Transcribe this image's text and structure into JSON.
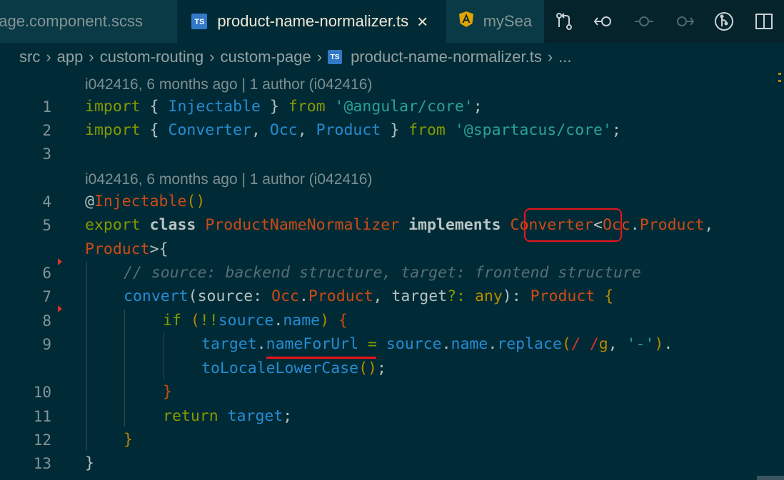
{
  "tabs": [
    {
      "label": "page.component.scss",
      "state": "inactive"
    },
    {
      "label": "product-name-normalizer.ts",
      "state": "active",
      "icon": "ts-icon",
      "badge": "TS"
    },
    {
      "label": "mySea",
      "state": "inactive",
      "icon": "angular-icon"
    }
  ],
  "toolbar": {
    "icons": [
      "source-control-compare-icon",
      "go-back-icon",
      "timeline-dot-icon",
      "go-forward-icon",
      "git-graph-icon",
      "split-editor-icon"
    ]
  },
  "breadcrumb": {
    "items": [
      "src",
      "app",
      "custom-routing",
      "custom-page",
      "product-name-normalizer.ts",
      "..."
    ],
    "file_badge": "TS"
  },
  "blame": [
    "i042416, 6 months ago | 1 author (i042416)",
    "i042416, 6 months ago | 1 author (i042416)"
  ],
  "line_numbers": [
    "1",
    "2",
    "3",
    "4",
    "5",
    "6",
    "7",
    "8",
    "9",
    "10",
    "11",
    "12",
    "13"
  ],
  "code": {
    "l1": {
      "kw": "import",
      "b1": " { ",
      "id": "Injectable",
      "b2": " } ",
      "from": "from",
      "sp": " ",
      "str": "'@angular/core'",
      "end": ";"
    },
    "l2": {
      "kw": "import",
      "b1": " { ",
      "id1": "Converter",
      "c1": ", ",
      "id2": "Occ",
      "c2": ", ",
      "id3": "Product",
      "b2": " } ",
      "from": "from",
      "sp": " ",
      "str": "'@spartacus/core'",
      "end": ";"
    },
    "l4": {
      "at": "@",
      "dec": "Injectable",
      "parens": "()"
    },
    "l5": {
      "kw1": "export",
      "sp1": " ",
      "kw2": "class",
      "sp2": " ",
      "cls": "ProductNameNormalizer",
      "sp3": " ",
      "kw3": "implements",
      "sp4": " ",
      "conv": "Converter",
      "lt": "<",
      "occ": "Occ",
      "dot": ".",
      "prod": "Product",
      "comma": ","
    },
    "l5b": {
      "prod": "Product",
      "gt": ">",
      "brace": "{"
    },
    "l6": {
      "comment": "// source: backend structure, target: frontend structure"
    },
    "l7": {
      "fn": "convert",
      "p1": "(",
      "src": "source",
      "col1": ": ",
      "occ": "Occ",
      "dot": ".",
      "prod": "Product",
      "c": ", ",
      "tgt": "target",
      "q": "?: ",
      "any": "any",
      "p2": "): ",
      "ret": "Product",
      "sp": " ",
      "brace": "{"
    },
    "l8": {
      "kw": "if",
      "sp": " ",
      "p1": "(",
      "not": "!!",
      "src": "source",
      "dot": ".",
      "name": "name",
      "p2": ")",
      "sp2": " ",
      "brace": "{"
    },
    "l9": {
      "tgt": "target",
      "dot1": ".",
      "prop": "nameForUrl",
      "eq": " = ",
      "src": "source",
      "dot2": ".",
      "name": "name",
      "dot3": ".",
      "fn": "replace",
      "p1": "(",
      "re1": "/ /",
      "flag": "g",
      "c": ", ",
      "str": "'-'",
      "p2": ")",
      "dot4": "."
    },
    "l9b": {
      "fn": "toLocaleLowerCase",
      "parens": "()",
      "end": ";"
    },
    "l10": {
      "brace": "}"
    },
    "l11": {
      "kw": "return",
      "sp": " ",
      "tgt": "target",
      "end": ";"
    },
    "l12": {
      "brace": "}"
    },
    "l13": {
      "brace": "}"
    }
  },
  "colors": {
    "background": "#002b36",
    "keyword": "#859900",
    "class_name": "#cb4b16",
    "identifier": "#268bd2",
    "string": "#2aa198",
    "annotation": "#e8141c"
  }
}
